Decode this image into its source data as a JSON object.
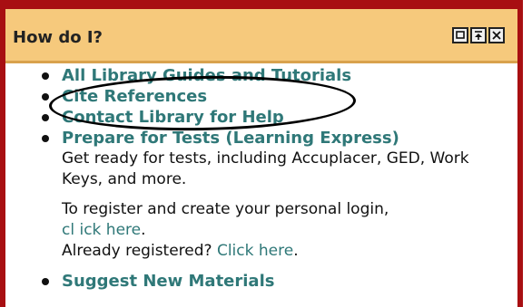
{
  "panel": {
    "title": "How do I?",
    "colors": {
      "frame": "#a80f12",
      "header_bg": "#f6c97c",
      "link": "#2f7878"
    }
  },
  "items": [
    {
      "label": "All Library Guides and Tutorials"
    },
    {
      "label": "Cite References"
    },
    {
      "label": "Contact Library for Help"
    },
    {
      "label": "Prepare for Tests (Learning Express)",
      "description": "Get ready for tests, including Accuplacer, GED, Work Keys, and more.",
      "register_text": "To register and create your personal login,",
      "register_link": "cl ick here",
      "register_suffix": ".",
      "already_text": "Already registered?",
      "already_link": "Click here",
      "already_suffix": "."
    },
    {
      "label": "Suggest New Materials"
    }
  ],
  "window_controls": [
    "restore-icon",
    "pin-icon",
    "close-icon"
  ]
}
